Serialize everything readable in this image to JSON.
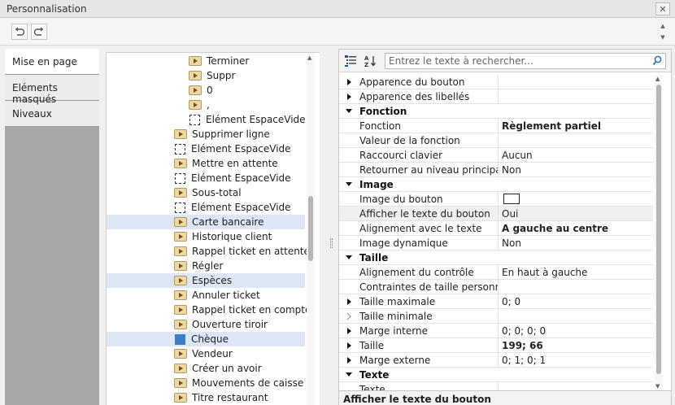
{
  "window": {
    "title": "Personnalisation",
    "close_glyph": "✕"
  },
  "toolbar": {
    "undo_icon": "undo-icon",
    "redo_icon": "redo-icon"
  },
  "tabs": [
    {
      "label": "Mise en page",
      "active": true
    },
    {
      "label": "Eléments masqués",
      "active": false
    },
    {
      "label": "Niveaux",
      "active": false
    }
  ],
  "tree": {
    "items": [
      {
        "label": "Terminer",
        "icon": "play-icon",
        "level": 2,
        "selected": false
      },
      {
        "label": "Suppr",
        "icon": "play-icon",
        "level": 2,
        "selected": false
      },
      {
        "label": "0",
        "icon": "play-icon",
        "level": 2,
        "selected": false
      },
      {
        "label": ",",
        "icon": "play-icon",
        "level": 2,
        "selected": false
      },
      {
        "label": "Elément EspaceVide",
        "icon": "empty-space-icon",
        "level": 2,
        "selected": false
      },
      {
        "label": "Supprimer ligne",
        "icon": "play-icon",
        "level": 1,
        "selected": false
      },
      {
        "label": "Elément EspaceVide",
        "icon": "empty-space-icon",
        "level": 1,
        "selected": false
      },
      {
        "label": "Mettre en attente",
        "icon": "play-icon",
        "level": 1,
        "selected": false
      },
      {
        "label": "Elément EspaceVide",
        "icon": "empty-space-icon",
        "level": 1,
        "selected": false
      },
      {
        "label": "Sous-total",
        "icon": "play-icon",
        "level": 1,
        "selected": false
      },
      {
        "label": "Elément EspaceVide",
        "icon": "empty-space-icon",
        "level": 1,
        "selected": false
      },
      {
        "label": "Carte bancaire",
        "icon": "play-icon",
        "level": 1,
        "selected": true
      },
      {
        "label": "Historique client",
        "icon": "play-icon",
        "level": 1,
        "selected": false
      },
      {
        "label": "Rappel ticket en attente",
        "icon": "play-icon",
        "level": 1,
        "selected": false
      },
      {
        "label": "Régler",
        "icon": "play-icon",
        "level": 1,
        "selected": false
      },
      {
        "label": "Espèces",
        "icon": "play-icon",
        "level": 1,
        "selected": true
      },
      {
        "label": "Annuler ticket",
        "icon": "play-icon",
        "level": 1,
        "selected": false
      },
      {
        "label": "Rappel ticket en compte",
        "icon": "play-icon",
        "level": 1,
        "selected": false
      },
      {
        "label": "Ouverture tiroir",
        "icon": "play-icon",
        "level": 1,
        "selected": false
      },
      {
        "label": "Chèque",
        "icon": "blue-square-icon",
        "level": 1,
        "selected": true
      },
      {
        "label": "Vendeur",
        "icon": "play-icon",
        "level": 1,
        "selected": false
      },
      {
        "label": "Créer un avoir",
        "icon": "play-icon",
        "level": 1,
        "selected": false
      },
      {
        "label": "Mouvements de caisse",
        "icon": "play-icon",
        "level": 1,
        "selected": false
      },
      {
        "label": "Titre restaurant",
        "icon": "play-icon",
        "level": 1,
        "selected": false
      }
    ]
  },
  "properties": {
    "search_placeholder": "Entrez le texte à rechercher...",
    "rows": [
      {
        "type": "prop",
        "expander": "right",
        "name": "Apparence du bouton",
        "value": ""
      },
      {
        "type": "prop",
        "expander": "right",
        "name": "Apparence des libellés",
        "value": ""
      },
      {
        "type": "category",
        "expander": "down",
        "name": "Fonction"
      },
      {
        "type": "prop",
        "expander": "",
        "name": "Fonction",
        "value": "Règlement partiel",
        "bold": true
      },
      {
        "type": "prop",
        "expander": "",
        "name": "Valeur de la fonction",
        "value": ""
      },
      {
        "type": "prop",
        "expander": "",
        "name": "Raccourci clavier",
        "value": "Aucun"
      },
      {
        "type": "prop",
        "expander": "",
        "name": "Retourner au niveau principal",
        "value": "Non"
      },
      {
        "type": "category",
        "expander": "down",
        "name": "Image"
      },
      {
        "type": "prop",
        "expander": "",
        "name": "Image du bouton",
        "value": "",
        "swatch": true
      },
      {
        "type": "prop",
        "expander": "",
        "name": "Afficher le texte du bouton",
        "value": "Oui",
        "highlight": true
      },
      {
        "type": "prop",
        "expander": "",
        "name": "Alignement avec le texte",
        "value": "A gauche au centre",
        "bold": true
      },
      {
        "type": "prop",
        "expander": "",
        "name": "Image dynamique",
        "value": "Non"
      },
      {
        "type": "category",
        "expander": "down",
        "name": "Taille"
      },
      {
        "type": "prop",
        "expander": "",
        "name": "Alignement du contrôle",
        "value": "En haut à gauche"
      },
      {
        "type": "prop",
        "expander": "",
        "name": "Contraintes de taille personnalisées",
        "value": ""
      },
      {
        "type": "prop",
        "expander": "right",
        "name": "Taille maximale",
        "value": "0; 0"
      },
      {
        "type": "prop",
        "expander": "right-light",
        "name": "Taille minimale",
        "value": ""
      },
      {
        "type": "prop",
        "expander": "right",
        "name": "Marge interne",
        "value": "0; 0; 0; 0"
      },
      {
        "type": "prop",
        "expander": "right",
        "name": "Taille",
        "value": "199; 66",
        "bold": true
      },
      {
        "type": "prop",
        "expander": "right",
        "name": "Marge externe",
        "value": "0; 1; 0; 1"
      },
      {
        "type": "category",
        "expander": "down",
        "name": "Texte"
      },
      {
        "type": "prop",
        "expander": "",
        "name": "Texte",
        "value": ""
      }
    ],
    "description": "Afficher le texte du bouton"
  },
  "colors": {
    "selection": "#dde6f4",
    "accent_blue": "#3b7ec5",
    "tab_strip": "#a7a7a7"
  }
}
